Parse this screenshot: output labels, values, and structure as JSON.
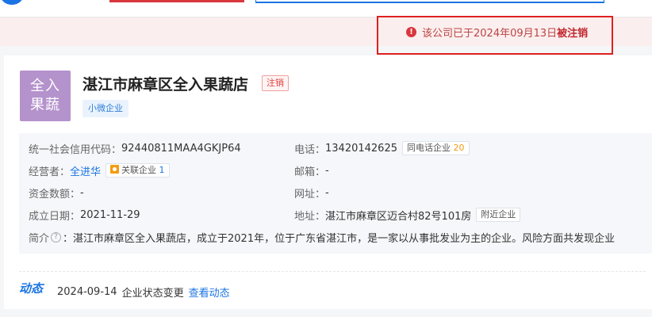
{
  "notice": {
    "text_prefix": "该公司已于2024年09月13日",
    "text_emphasis": "被注销",
    "icon": "exclamation-circle-icon"
  },
  "company": {
    "logo_text_line1": "全入",
    "logo_text_line2": "果蔬",
    "name": "湛江市麻章区全入果蔬店",
    "status_tag": "注销",
    "size_tag": "小微企业"
  },
  "info": {
    "credit_code_label": "统一社会信用代码：",
    "credit_code_value": "92440811MAA4GKJP64",
    "phone_label": "电话：",
    "phone_value": "13420142625",
    "phone_tag_label": "同电话企业",
    "phone_tag_count": "20",
    "operator_label": "经营者：",
    "operator_value": "全进华",
    "related_tag_label": "关联企业",
    "related_tag_count": "1",
    "email_label": "邮箱：",
    "email_value": "-",
    "capital_label": "资金数额：",
    "capital_value": "-",
    "website_label": "网址：",
    "website_value": "-",
    "founded_label": "成立日期：",
    "founded_value": "2021-11-29",
    "address_label": "地址：",
    "address_value": "湛江市麻章区迈合村82号101房",
    "address_tag": "附近企业",
    "intro_label": "简介",
    "intro_value": "：湛江市麻章区全入果蔬店，成立于2021年，位于广东省湛江市，是一家以从事批发业为主的企业。风险方面共发现企业"
  },
  "dynamic": {
    "title": "动态",
    "date": "2024-09-14",
    "event": "企业状态变更",
    "link": "查看动态"
  },
  "colors": {
    "accent": "#1b74e4",
    "danger": "#e02020",
    "logo_bg": "#b492cc"
  }
}
